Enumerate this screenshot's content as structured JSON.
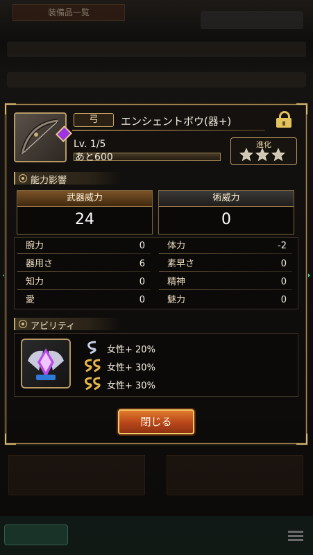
{
  "background": {
    "screen_title": "装備品一覧"
  },
  "weapon": {
    "type_label": "弓",
    "name": "エンシェントボウ(器+)",
    "level_prefix": "Lv.",
    "level": "1/5",
    "exp_remaining": "あと600",
    "evolution_label": "進化",
    "evolution_stars": 3,
    "evolution_stars_max": 3,
    "locked": true
  },
  "stats_section": {
    "title": "能力影響",
    "weapon_power_label": "武器威力",
    "weapon_power_value": "24",
    "magic_power_label": "術威力",
    "magic_power_value": "0",
    "stats": [
      {
        "name": "腕力",
        "value": "0"
      },
      {
        "name": "体力",
        "value": "-2"
      },
      {
        "name": "器用さ",
        "value": "6"
      },
      {
        "name": "素早さ",
        "value": "0"
      },
      {
        "name": "知力",
        "value": "0"
      },
      {
        "name": "精神",
        "value": "0"
      },
      {
        "name": "愛",
        "value": "0"
      },
      {
        "name": "魅力",
        "value": "0"
      }
    ]
  },
  "ability_section": {
    "title": "アビリティ",
    "abilities": [
      {
        "rank_icon": "s-single-rank-icon",
        "text": "女性+ 20%"
      },
      {
        "rank_icon": "ss-gold-rank-icon",
        "text": "女性+ 30%"
      },
      {
        "rank_icon": "ss-gold-rank-icon",
        "text": "女性+ 30%"
      }
    ]
  },
  "close_button_label": "閉じる",
  "colors": {
    "accent_gold": "#d4b774",
    "close_button": "#c9561f",
    "nav_arrow": "#3fd4a3",
    "gem_purple": "#9b34e0"
  }
}
